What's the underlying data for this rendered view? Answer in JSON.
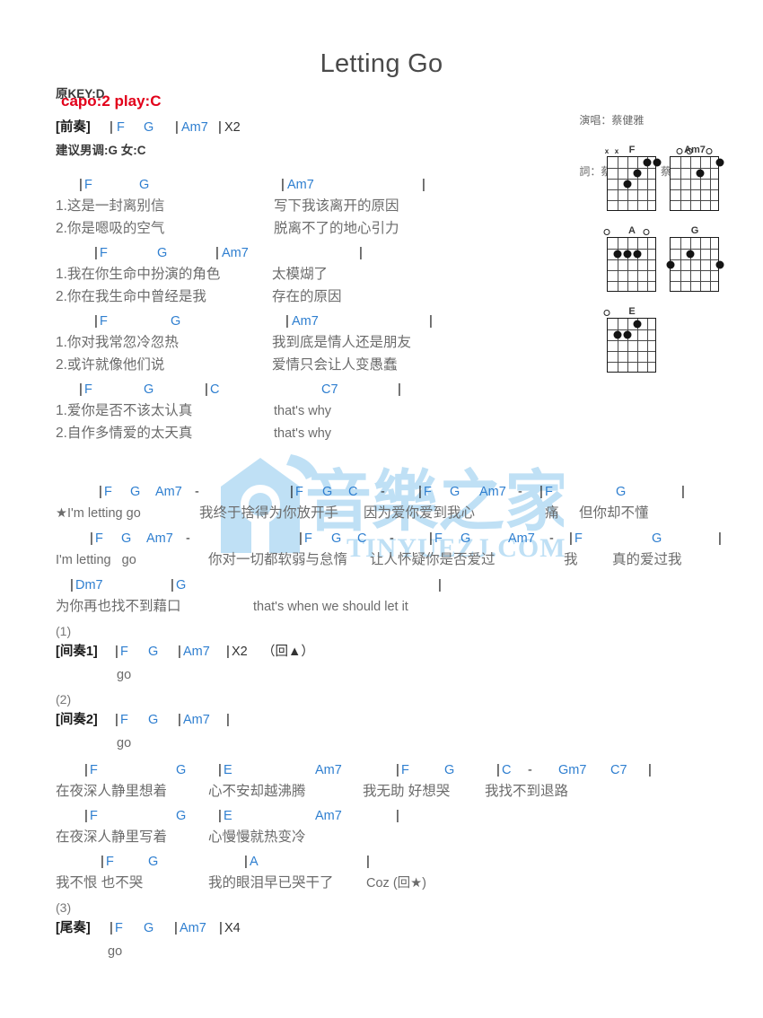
{
  "header": {
    "original_key": "原KEY:D",
    "suggested_key": "建议男调:G 女:C",
    "capo": "capo:2 play:C",
    "title": "Letting Go",
    "singer": "演唱：蔡健雅",
    "writer": "詞：蔡健雅  曲：蔡健雅"
  },
  "intro": {
    "section": "[前奏]",
    "bar1": "|",
    "F": "F",
    "G": "G",
    "bar2": "|",
    "Am7": "Am7",
    "bar3": "|",
    "repeat": "X2"
  },
  "verse1": {
    "line1": {
      "bar1": "|",
      "F": "F",
      "G": "G",
      "bar2": "|",
      "Am7": "Am7",
      "bar3": "|",
      "lyric1": "1.这是一封离别信",
      "lyric1b": "写下我该离开的原因",
      "lyric2": "2.你是嗯吸的空气",
      "lyric2b": "脱离不了的地心引力"
    },
    "line2": {
      "bar1": "|",
      "F": "F",
      "G": "G",
      "bar2": "|",
      "Am7": "Am7",
      "bar3": "|",
      "lyric1": "1.我在你生命中扮演的角色",
      "lyric1b": "太模煳了",
      "lyric2": "2.你在我生命中曾经是我",
      "lyric2b": "存在的原因"
    },
    "line3": {
      "bar1": "|",
      "F": "F",
      "G": "G",
      "bar2": "|",
      "Am7": "Am7",
      "bar3": "|",
      "lyric1": "1.你对我常忽冷忽热",
      "lyric1b": "我到底是情人还是朋友",
      "lyric2": "2.或许就像他们说",
      "lyric2b": "爱情只会让人变愚蠢"
    },
    "line4": {
      "bar1": "|",
      "F": "F",
      "G": "G",
      "bar2": "|",
      "C": "C",
      "C7": "C7",
      "bar3": "|",
      "lyric1": "1.爱你是否不该太认真",
      "lyric1b": "that's why",
      "lyric2": "2.自作多情爱的太天真",
      "lyric2b": "that's why"
    }
  },
  "chorus": {
    "line1": {
      "bar1": "|",
      "F1": "F",
      "G1": "G",
      "Am71": "Am7",
      "dash1": "-",
      "bar2": "|",
      "F2": "F",
      "G2": "G",
      "C2": "C",
      "dash2": "-",
      "bar3": "|",
      "F3": "F",
      "G3": "G",
      "Am73": "Am7",
      "dash3": "-",
      "bar4": "|",
      "F4": "F",
      "G4": "G",
      "bar5": "|",
      "lyric_star": "★I'm letting go",
      "lyric_a": "我终于捨得为你放开手",
      "lyric_b": "因为爱你爱到我心",
      "lyric_c": "痛",
      "lyric_d": "但你却不懂"
    },
    "line2": {
      "bar1": "|",
      "F1": "F",
      "G1": "G",
      "Am71": "Am7",
      "dash1": "-",
      "bar2": "|",
      "F2": "F",
      "G2": "G",
      "C2": "C",
      "dash2": "-",
      "bar3": "|",
      "F3": "F",
      "G3": "G",
      "Am73": "Am7",
      "dash3": "-",
      "bar4": "|",
      "F4": "F",
      "G4": "G",
      "bar5": "|",
      "lyric_star": "I'm letting   go",
      "lyric_a": "你对一切都软弱与怠惰",
      "lyric_b": "让人怀疑你是否爱过",
      "lyric_c": "我",
      "lyric_d": "真的爱过我"
    },
    "line3": {
      "bar1": "|",
      "Dm7": "Dm7",
      "bar2": "|",
      "G": "G",
      "bar3": "|",
      "lyric_a": "为你再也找不到藉口",
      "lyric_b": "that's when we should let it"
    }
  },
  "interlude1": {
    "number": "(1)",
    "section": "[间奏1]",
    "bar1": "|",
    "F": "F",
    "G": "G",
    "bar2": "|",
    "Am7": "Am7",
    "bar3": "|",
    "repeat": "X2",
    "note": "（回▲）",
    "go": "go"
  },
  "interlude2": {
    "number": "(2)",
    "section": "[间奏2]",
    "bar1": "|",
    "F": "F",
    "G": "G",
    "bar2": "|",
    "Am7": "Am7",
    "bar3": "|",
    "go": "go"
  },
  "bridge": {
    "line1": {
      "bar1": "|",
      "F": "F",
      "G": "G",
      "bar2": "|",
      "E": "E",
      "Am7": "Am7",
      "bar3": "|",
      "F2": "F",
      "G2": "G",
      "bar4": "|",
      "C": "C",
      "dash": "-",
      "Gm7": "Gm7",
      "C7": "C7",
      "bar5": "|",
      "lyric_a": "在夜深人静里想着",
      "lyric_b": "心不安却越沸腾",
      "lyric_c": "我无助 好想哭",
      "lyric_d": "我找不到退路"
    },
    "line2": {
      "bar1": "|",
      "F": "F",
      "G": "G",
      "bar2": "|",
      "E": "E",
      "Am7": "Am7",
      "bar3": "|",
      "lyric_a": "在夜深人静里写着",
      "lyric_b": "心慢慢就热变冷"
    },
    "line3": {
      "bar1": "|",
      "F": "F",
      "G": "G",
      "bar2": "|",
      "A": "A",
      "bar3": "|",
      "lyric_a": "我不恨 也不哭",
      "lyric_b": "我的眼泪早已哭干了",
      "lyric_c": "Coz (回★)"
    }
  },
  "outro": {
    "number": "(3)",
    "section": "[尾奏]",
    "bar1": "|",
    "F": "F",
    "G": "G",
    "bar2": "|",
    "Am7": "Am7",
    "bar3": "|",
    "repeat": "X4",
    "go": "go"
  },
  "diagrams": [
    {
      "name": "F",
      "marks": [
        {
          "s": 0,
          "t": "x"
        },
        {
          "s": 1,
          "t": "x"
        }
      ],
      "dots": [
        {
          "s": 2,
          "f": 3
        },
        {
          "s": 3,
          "f": 2
        },
        {
          "s": 4,
          "f": 1
        },
        {
          "s": 5,
          "f": 1
        }
      ]
    },
    {
      "name": "Am7",
      "marks": [
        {
          "s": 1,
          "t": "o"
        },
        {
          "s": 2,
          "t": "o"
        },
        {
          "s": 4,
          "t": "o"
        }
      ],
      "dots": [
        {
          "s": 3,
          "f": 2
        },
        {
          "s": 5,
          "f": 1
        }
      ]
    },
    {
      "name": "A",
      "marks": [
        {
          "s": 0,
          "t": "o"
        },
        {
          "s": 4,
          "t": "o"
        }
      ],
      "dots": [
        {
          "s": 1,
          "f": 2
        },
        {
          "s": 2,
          "f": 2
        },
        {
          "s": 3,
          "f": 2
        }
      ]
    },
    {
      "name": "G",
      "marks": [],
      "dots": [
        {
          "s": 0,
          "f": 3
        },
        {
          "s": 2,
          "f": 2
        },
        {
          "s": 5,
          "f": 3
        }
      ]
    },
    {
      "name": "E",
      "marks": [
        {
          "s": 0,
          "t": "o"
        }
      ],
      "dots": [
        {
          "s": 1,
          "f": 2
        },
        {
          "s": 2,
          "f": 2
        },
        {
          "s": 3,
          "f": 1
        }
      ]
    }
  ],
  "watermark": {
    "text": "TINYUEZJ.COM",
    "color": "#bfe0f5"
  }
}
